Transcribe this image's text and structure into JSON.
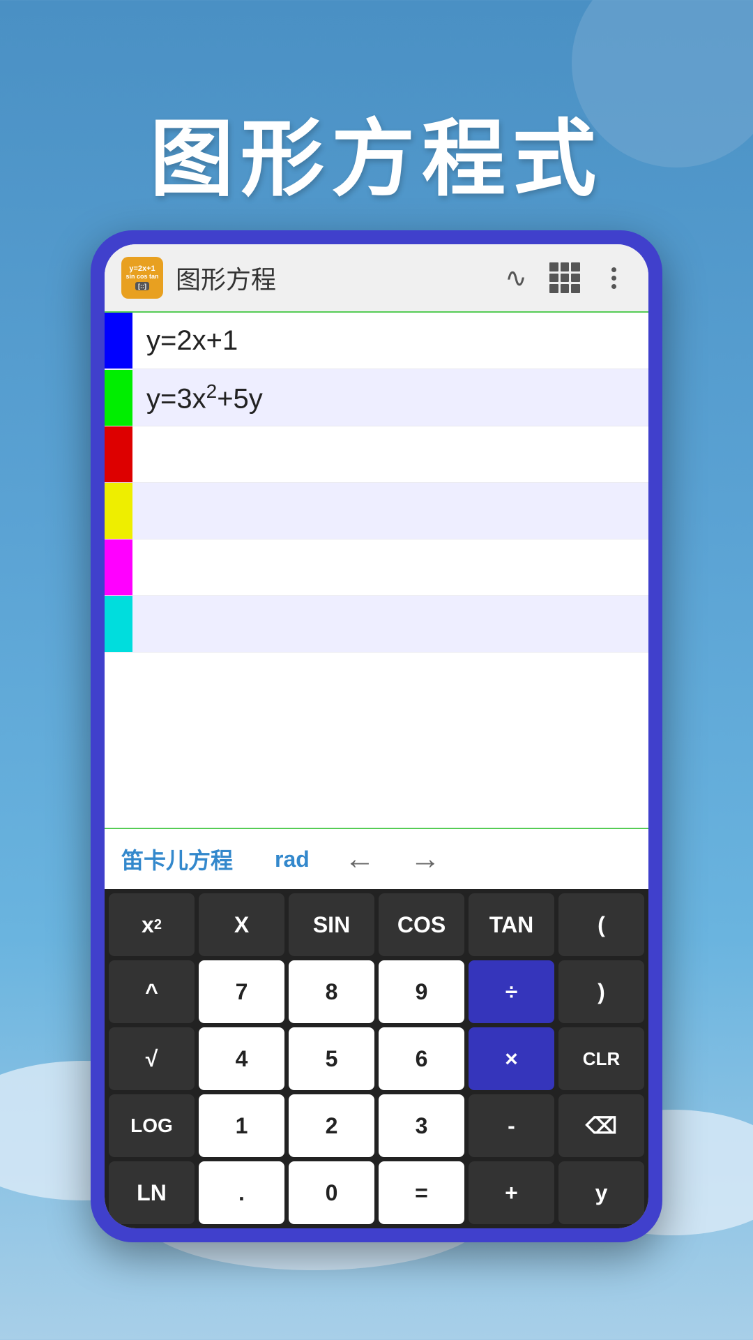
{
  "background": {
    "gradient_start": "#4a90c4",
    "gradient_end": "#a8cfe8"
  },
  "title": "图形方程式",
  "app": {
    "header_title": "图形方程",
    "icon_top": "y=2x+1",
    "icon_mid": "sin cos tan",
    "icon_bottom": "[::]",
    "wave_icon": "∿",
    "bottom_cartesian": "笛卡儿方程",
    "bottom_rad": "rad",
    "arrow_left": "←",
    "arrow_right": "→"
  },
  "equations": [
    {
      "color": "#0000ff",
      "text": "y=2x+1",
      "row_bg": "white"
    },
    {
      "color": "#00ee00",
      "text": "y=3x²+5y",
      "row_bg": "#eeeeff"
    },
    {
      "color": "#dd0000",
      "text": "",
      "row_bg": "white"
    },
    {
      "color": "#eeee00",
      "text": "",
      "row_bg": "#eeeeff"
    },
    {
      "color": "#ff00ff",
      "text": "",
      "row_bg": "white"
    },
    {
      "color": "#00eeee",
      "text": "",
      "row_bg": "#eeeeff"
    }
  ],
  "keyboard": {
    "rows": [
      [
        {
          "label": "x²",
          "type": "dark",
          "sup": true
        },
        {
          "label": "X",
          "type": "dark"
        },
        {
          "label": "SIN",
          "type": "dark"
        },
        {
          "label": "COS",
          "type": "dark"
        },
        {
          "label": "TAN",
          "type": "dark"
        },
        {
          "label": "(",
          "type": "dark"
        }
      ],
      [
        {
          "label": "^",
          "type": "dark"
        },
        {
          "label": "7",
          "type": "white"
        },
        {
          "label": "8",
          "type": "white"
        },
        {
          "label": "9",
          "type": "white"
        },
        {
          "label": "÷",
          "type": "blue"
        },
        {
          "label": ")",
          "type": "dark"
        }
      ],
      [
        {
          "label": "√",
          "type": "dark"
        },
        {
          "label": "4",
          "type": "white"
        },
        {
          "label": "5",
          "type": "white"
        },
        {
          "label": "6",
          "type": "white"
        },
        {
          "label": "×",
          "type": "blue"
        },
        {
          "label": "CLR",
          "type": "dark"
        }
      ],
      [
        {
          "label": "LOG",
          "type": "dark"
        },
        {
          "label": "1",
          "type": "white"
        },
        {
          "label": "2",
          "type": "white"
        },
        {
          "label": "3",
          "type": "white"
        },
        {
          "label": "-",
          "type": "dark"
        },
        {
          "label": "⌫",
          "type": "dark"
        }
      ],
      [
        {
          "label": "LN",
          "type": "dark"
        },
        {
          "label": ".",
          "type": "white"
        },
        {
          "label": "0",
          "type": "white"
        },
        {
          "label": "=",
          "type": "white"
        },
        {
          "label": "+",
          "type": "dark"
        },
        {
          "label": "y",
          "type": "dark"
        }
      ]
    ]
  }
}
